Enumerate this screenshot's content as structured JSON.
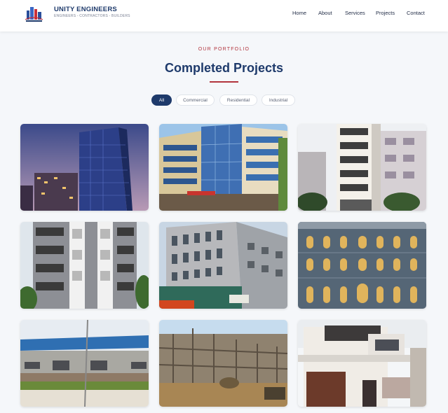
{
  "brand": {
    "name": "UNITY ENGINEERS",
    "tagline": "ENGINEERS - CONTRACTORS - BUILDERS"
  },
  "nav": {
    "items": [
      "Home",
      "About",
      "Services",
      "Projects",
      "Contact"
    ]
  },
  "section": {
    "eyebrow": "OUR PORTFOLIO",
    "title": "Completed Projects"
  },
  "filters": {
    "items": [
      "All",
      "Commercial",
      "Residential",
      "Industrial"
    ],
    "selected": "All"
  },
  "projects": [
    {
      "icon": "glass-tower-dusk-photo"
    },
    {
      "icon": "glass-office-building-photo"
    },
    {
      "icon": "white-residential-tower-photo"
    },
    {
      "icon": "grey-apartment-block-photo"
    },
    {
      "icon": "concrete-office-building-photo"
    },
    {
      "icon": "ornate-arched-facade-photo"
    },
    {
      "icon": "blue-roof-warehouse-photo"
    },
    {
      "icon": "construction-site-photo"
    },
    {
      "icon": "white-house-photo"
    }
  ],
  "colors": {
    "brand_blue": "#1e3a6b",
    "accent_red": "#b2343d",
    "page_bg": "#f5f7fa"
  }
}
